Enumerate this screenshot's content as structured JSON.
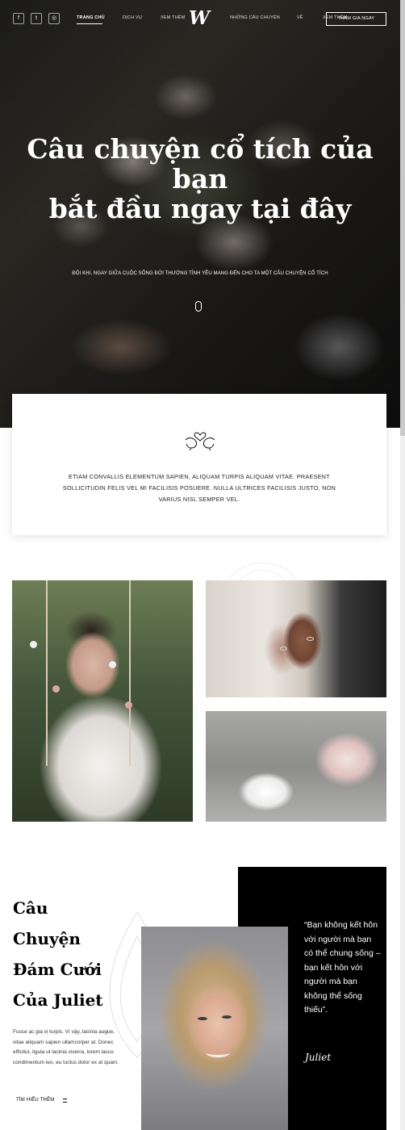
{
  "nav": {
    "social": [
      {
        "icon": "facebook-icon",
        "glyph": "f"
      },
      {
        "icon": "twitter-icon",
        "glyph": "t"
      },
      {
        "icon": "instagram-icon",
        "glyph": "◎"
      }
    ],
    "links": [
      "TRANG CHỦ",
      "DỊCH VỤ",
      "XEM THÊM",
      "NHỮNG CÂU CHUYỆN",
      "VỀ",
      "XEM THÊM"
    ],
    "logo": "W",
    "cta": "THAM GIA NGAY"
  },
  "hero": {
    "title_line1": "Câu chuyện cổ tích của",
    "title_line2": "bạn",
    "title_line3": "bắt đầu ngay tại đây",
    "subtitle": "ĐÔI KHI, NGAY GIỮA CUỘC SỐNG ĐỜI THƯỜNG TÌNH YÊU MANG ĐẾN CHO TA MỘT CÂU CHUYỆN CỔ TÍCH"
  },
  "intro": {
    "icon": "doves-heart-icon",
    "text": "ETIAM CONVALLIS ELEMENTUM SAPIEN, ALIQUAM TURPIS ALIQUAM VITAE. PRAESENT SOLLICITUDIN FELIS VEL MI FACILISIS POSUERE. NULLA ULTRICES FACILISIS JUSTO, NON VARIUS NISL SEMPER VEL."
  },
  "story": {
    "title_line1": "Câu",
    "title_line2": "Chuyện",
    "title_line3": "Đám Cưới",
    "title_line4": "Của Juliet",
    "body": "Fusce ac gia vị turpis. Vì vậy, lacinia augue, vitae aliquam sapien ullamcorper at. Donec efficitur, ligula ut lacinia viverra, lorem lacus condimentum leo, eu luctus dolor ex at quam.",
    "learn_more": "TÌM HIỂU THÊM",
    "quote": "“Bạn không kết hôn với người mà bạn có thể chung sống – bạn kết hôn với người mà bạn không thể sống thiếu”.",
    "signature": "Juliet"
  },
  "colors": {
    "accent": "#000000",
    "text": "#222222",
    "background": "#ffffff"
  }
}
